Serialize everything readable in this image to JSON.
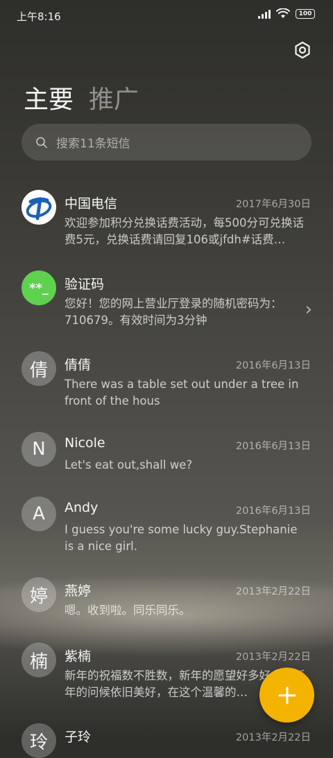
{
  "status_bar": {
    "time": "上午8:16",
    "battery": "100"
  },
  "tabs": {
    "primary": "主要",
    "promotions": "推广"
  },
  "search": {
    "placeholder": "搜索11条短信"
  },
  "conversations": [
    {
      "avatar_type": "telecom-logo",
      "name": "中国电信",
      "date": "2017年6月30日",
      "preview": "欢迎参加积分兑换话费活动，每500分可兑换话费5元，兑换话费请回复106或jfdh#话费…"
    },
    {
      "avatar_type": "code",
      "avatar_text": "**_",
      "avatar_color": "#5ed24e",
      "name": "验证码",
      "date": "",
      "preview": "您好！您的网上营业厅登录的随机密码为：710679。有效时间为3分钟",
      "chevron": "›"
    },
    {
      "avatar_text": "倩",
      "name": "倩倩",
      "date": "2016年6月13日",
      "preview": "There was a table set out under a tree in front of the hous"
    },
    {
      "avatar_text": "N",
      "name": "Nicole",
      "date": "2016年6月13日",
      "preview": "Let's eat out,shall we?"
    },
    {
      "avatar_text": "A",
      "name": "Andy",
      "date": "2016年6月13日",
      "preview": "I guess you're some lucky guy.Stephanie is a nice girl."
    },
    {
      "avatar_text": "婷",
      "name": "燕婷",
      "date": "2013年2月22日",
      "preview": "嗯。收到啦。同乐同乐。"
    },
    {
      "avatar_text": "楠",
      "name": "紫楠",
      "date": "2013年2月22日",
      "preview": "新年的祝福数不胜数，新年的愿望好多好多，新年的问候依旧美好，在这个温馨的…"
    },
    {
      "avatar_text": "玲",
      "name": "子玲",
      "date": "2013年2月22日",
      "preview": ""
    }
  ],
  "fab": {
    "label": "+",
    "color": "#f5b301"
  }
}
